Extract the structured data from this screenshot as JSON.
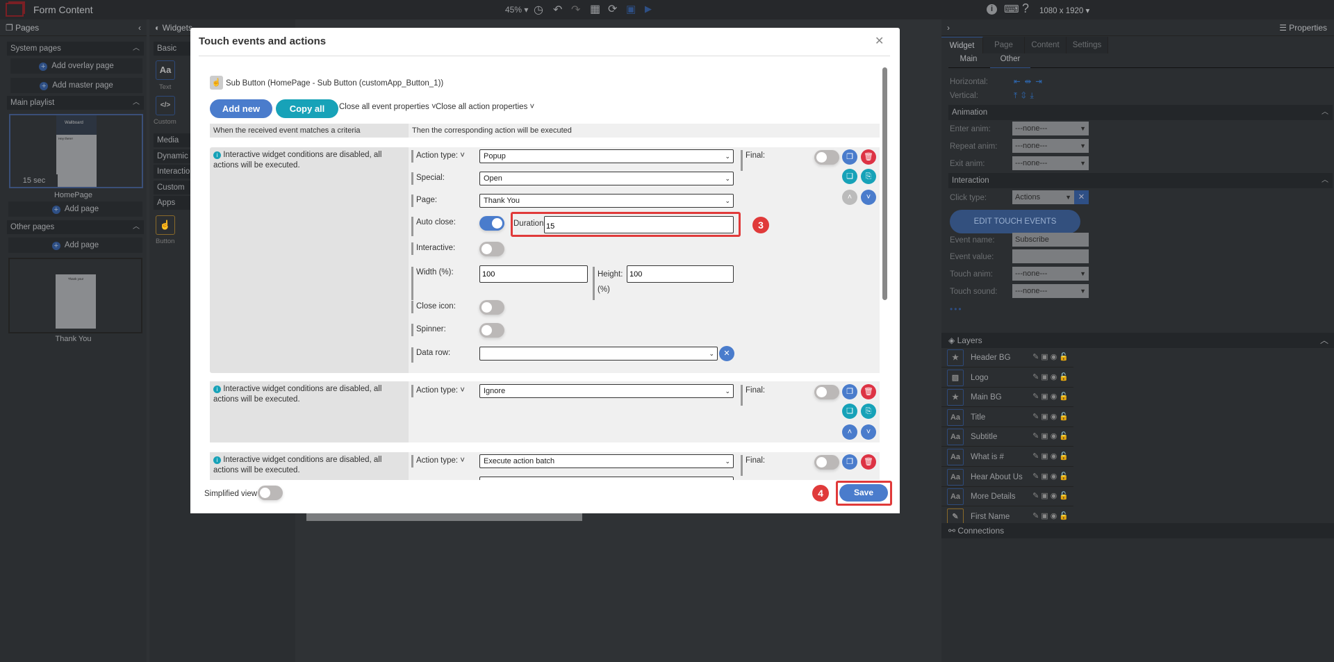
{
  "topbar": {
    "title": "Form Content",
    "zoom": "45%",
    "resolution": "1080 x 1920"
  },
  "pages": {
    "header": "Pages",
    "system_pages": "System pages",
    "add_overlay": "Add overlay page",
    "add_master": "Add master page",
    "main_playlist": "Main playlist",
    "duration": "15",
    "duration_unit": "sec",
    "homepage": "HomePage",
    "add_page": "Add page",
    "other_pages": "Other pages",
    "thank_you": "Thank You",
    "thumb_brand": "Wallboard",
    "thumb_hey": "Hey there!",
    "thumb_thanks": "Thank you!"
  },
  "widgets": {
    "header": "Widgets",
    "basic": "Basic",
    "text": "Text",
    "custom_w": "Custom",
    "media": "Media",
    "dynamic": "Dynamic c",
    "interaction": "Interactio",
    "custom": "Custom",
    "apps": "Apps",
    "button": "Button"
  },
  "modal": {
    "title": "Touch events and actions",
    "widget_ref": "Sub Button (HomePage - Sub Button (customApp_Button_1))",
    "add_new": "Add new",
    "copy_all": "Copy all",
    "close_event_props": "Close all event properties",
    "close_action_props": "Close all action properties",
    "col_left": "When the received event matches a criteria",
    "col_right": "Then the corresponding action will be executed",
    "info": "Interactive widget conditions are disabled, all actions will be executed.",
    "block1": {
      "action_type_label": "Action type:",
      "action_type": "Popup",
      "final_label": "Final:",
      "special_label": "Special:",
      "special": "Open",
      "page_label": "Page:",
      "page": "Thank You",
      "auto_close_label": "Auto close:",
      "auto_close": true,
      "duration_label": "Duration:",
      "duration": "15",
      "interactive_label": "Interactive:",
      "interactive": false,
      "width_label": "Width (%):",
      "width": "100",
      "height_label": "Height:",
      "height_unit": "(%)",
      "height": "100",
      "close_icon_label": "Close icon:",
      "close_icon": false,
      "spinner_label": "Spinner:",
      "spinner": false,
      "data_row_label": "Data row:",
      "data_row": ""
    },
    "block2": {
      "action_type": "Ignore"
    },
    "block3": {
      "action_type": "Execute action batch"
    },
    "simplified_view": "Simplified view",
    "save": "Save",
    "callout_3": "3",
    "callout_4": "4"
  },
  "properties": {
    "header": "Properties",
    "tabs": [
      "Widget",
      "Page",
      "Content",
      "Settings"
    ],
    "subtabs": [
      "Main",
      "Other"
    ],
    "horizontal": "Horizontal:",
    "vertical": "Vertical:",
    "animation": "Animation",
    "anim_rows": [
      {
        "label": "Enter anim:",
        "value": "---none---"
      },
      {
        "label": "Repeat anim:",
        "value": "---none---"
      },
      {
        "label": "Exit anim:",
        "value": "---none---"
      }
    ],
    "interaction": "Interaction",
    "click_type_label": "Click type:",
    "click_type": "Actions",
    "edit_touch": "EDIT TOUCH EVENTS",
    "event_name_label": "Event name:",
    "event_name": "Subscribe",
    "event_value_label": "Event value:",
    "event_value": "",
    "touch_anim_label": "Touch anim:",
    "touch_anim": "---none---",
    "touch_sound_label": "Touch sound:",
    "touch_sound": "---none---"
  },
  "layers": {
    "header": "Layers",
    "items": [
      {
        "name": "Header BG",
        "icon": "star"
      },
      {
        "name": "Logo",
        "icon": "image"
      },
      {
        "name": "Main BG",
        "icon": "star"
      },
      {
        "name": "Title",
        "icon": "text"
      },
      {
        "name": "Subtitle",
        "icon": "text"
      },
      {
        "name": "What is #",
        "icon": "text"
      },
      {
        "name": "Hear About Us",
        "icon": "text"
      },
      {
        "name": "More Details",
        "icon": "text"
      },
      {
        "name": "First Name",
        "icon": "form"
      }
    ]
  },
  "connections": "Connections",
  "colors": {
    "accent": "#4a7ccc",
    "teal": "#17a2b8",
    "danger": "#dd3344",
    "callout": "#e03a3a"
  }
}
